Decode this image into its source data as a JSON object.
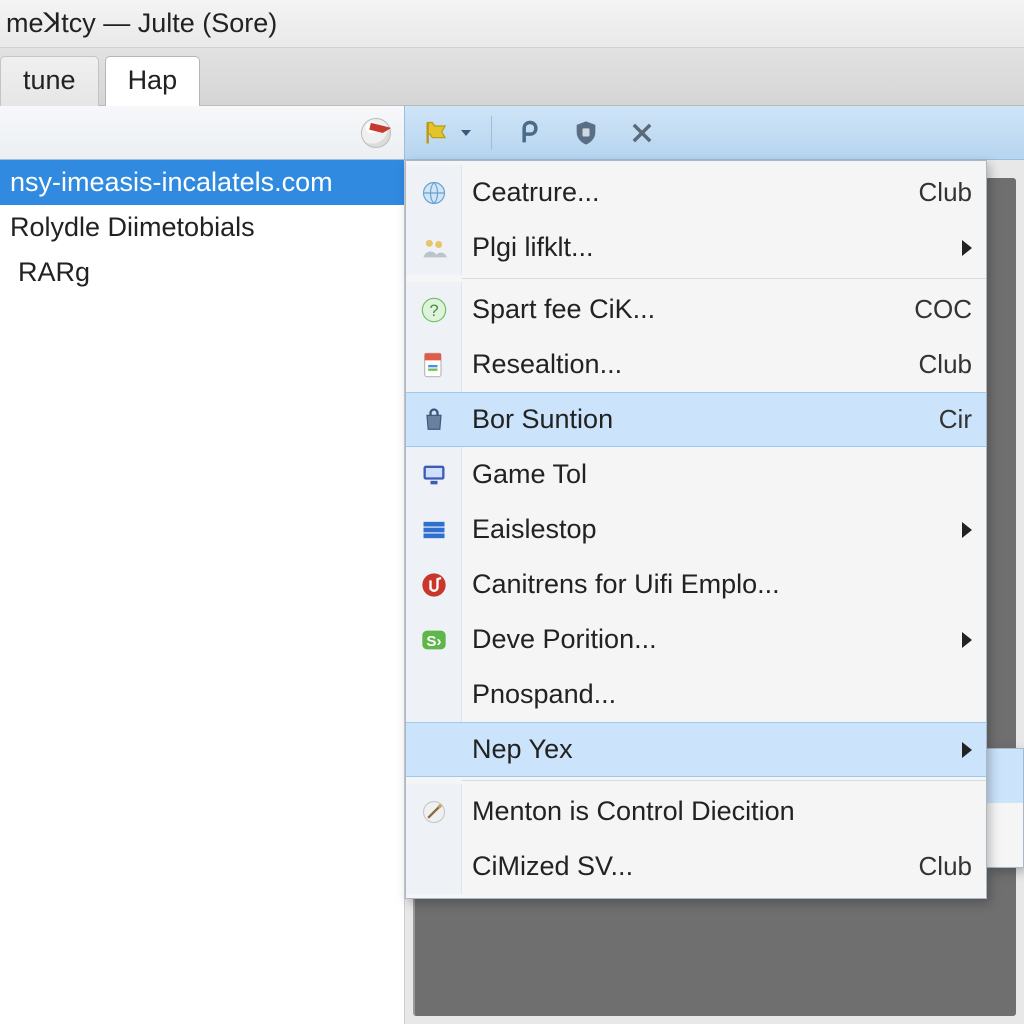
{
  "window": {
    "title": "meꓘtcy — Julte (Sore)"
  },
  "tabs": [
    {
      "label": "tune",
      "active": false
    },
    {
      "label": "Hap",
      "active": true
    }
  ],
  "toolbar": {
    "left_icon": "ball-icon",
    "buttons": [
      {
        "name": "flag-icon",
        "hasDropdown": true
      },
      {
        "name": "rho-icon"
      },
      {
        "name": "shield-icon"
      },
      {
        "name": "close-icon"
      }
    ]
  },
  "sidebar": {
    "items": [
      {
        "label": "nsy-imeasis-incalatels.com",
        "selected": true
      },
      {
        "label": "Rolydle Diimetobials",
        "selected": false
      },
      {
        "label": "RARg",
        "selected": false
      }
    ]
  },
  "context_menu": {
    "groups": [
      [
        {
          "icon": "globe-icon",
          "label": "Ceatrure...",
          "shortcut": "Club",
          "submenu": false
        },
        {
          "icon": "people-icon",
          "label": "Plgi lifklt...",
          "shortcut": "",
          "submenu": true
        }
      ],
      [
        {
          "icon": "question-icon",
          "label": "Spart fee CiK...",
          "shortcut": "COC",
          "submenu": false
        },
        {
          "icon": "doc-color-icon",
          "label": "Resealtion...",
          "shortcut": "Club",
          "submenu": false
        },
        {
          "icon": "bag-icon",
          "label": "Bor Suntion",
          "shortcut": "Cir",
          "submenu": false,
          "hover": true
        },
        {
          "icon": "monitor-icon",
          "label": "Game Tol",
          "shortcut": "",
          "submenu": false
        },
        {
          "icon": "bars-icon",
          "label": "Eaislestop",
          "shortcut": "",
          "submenu": true
        },
        {
          "icon": "red-note-icon",
          "label": "Canitrens for Uifi Emplo...",
          "shortcut": "",
          "submenu": false
        },
        {
          "icon": "green-s-icon",
          "label": "Deve Porition...",
          "shortcut": "",
          "submenu": true
        },
        {
          "icon": "",
          "label": "Pnospand...",
          "shortcut": "",
          "submenu": false
        },
        {
          "icon": "",
          "label": "Nep Yex",
          "shortcut": "",
          "submenu": true,
          "hover": true
        }
      ],
      [
        {
          "icon": "wand-icon",
          "label": "Menton is Control Diecition",
          "shortcut": "",
          "submenu": false
        },
        {
          "icon": "",
          "label": "CiMized SV...",
          "shortcut": "Club",
          "submenu": false
        }
      ]
    ]
  }
}
